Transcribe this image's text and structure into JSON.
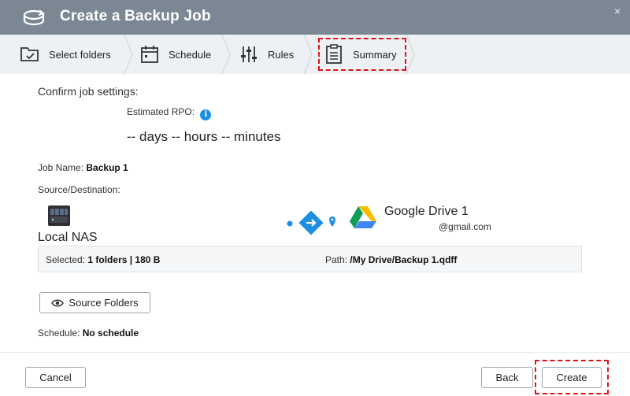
{
  "window": {
    "title": "Create a Backup Job",
    "close_glyph": "×"
  },
  "steps": [
    {
      "label": "Select folders",
      "icon": "folder-check-icon"
    },
    {
      "label": "Schedule",
      "icon": "calendar-icon"
    },
    {
      "label": "Rules",
      "icon": "sliders-icon"
    },
    {
      "label": "Summary",
      "icon": "clipboard-icon",
      "active": true
    }
  ],
  "summary": {
    "confirm_label": "Confirm job settings:",
    "rpo_label": "Estimated RPO:",
    "rpo_value": "-- days -- hours -- minutes",
    "job_name_label": "Job Name:",
    "job_name_value": "Backup 1",
    "source_dest_label": "Source/Destination:",
    "source_label": "Local NAS",
    "destination_label": "Google Drive 1",
    "destination_account": "@gmail.com",
    "selected_label": "Selected:",
    "selected_value": "1 folders | 180 B",
    "path_label": "Path:",
    "path_value": "/My Drive/Backup 1.qdff",
    "source_folders_button": "Source Folders",
    "schedule_label": "Schedule:",
    "schedule_value": "No schedule"
  },
  "footer": {
    "cancel": "Cancel",
    "back": "Back",
    "create": "Create"
  },
  "colors": {
    "titlebar": "#7b8793",
    "accent": "#1a8fe3",
    "highlight": "#e0131a"
  }
}
